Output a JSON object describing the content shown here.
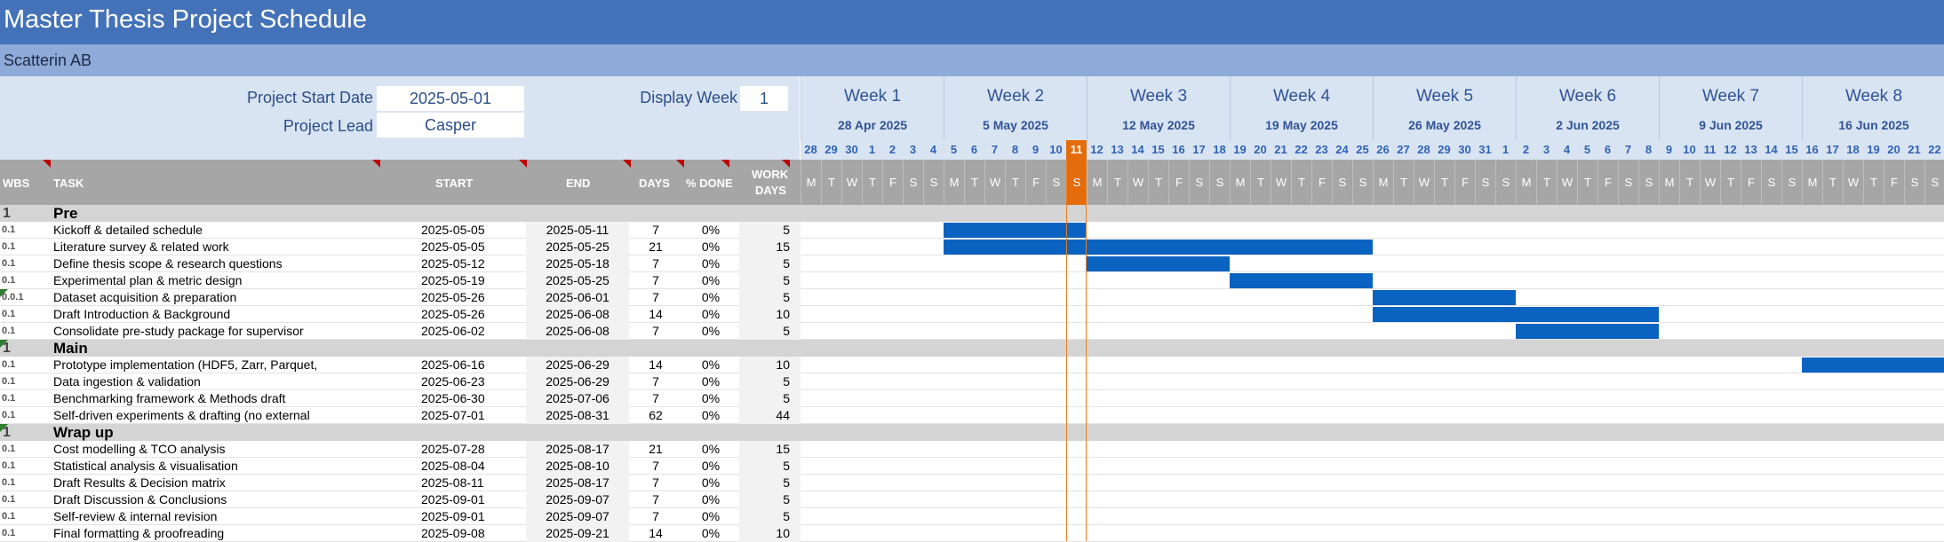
{
  "title": "Master Thesis Project Schedule",
  "company": "Scatterin AB",
  "info": {
    "start_label": "Project Start Date",
    "start_value": "2025-05-01",
    "lead_label": "Project Lead",
    "lead_value": "Casper",
    "display_week_label": "Display Week",
    "display_week_value": "1"
  },
  "weeks": [
    {
      "label": "Week 1",
      "date": "28 Apr 2025",
      "days": [
        "28",
        "29",
        "30",
        "1",
        "2",
        "3",
        "4"
      ]
    },
    {
      "label": "Week 2",
      "date": "5 May 2025",
      "days": [
        "5",
        "6",
        "7",
        "8",
        "9",
        "10",
        "11"
      ]
    },
    {
      "label": "Week 3",
      "date": "12 May 2025",
      "days": [
        "12",
        "13",
        "14",
        "15",
        "16",
        "17",
        "18"
      ]
    },
    {
      "label": "Week 4",
      "date": "19 May 2025",
      "days": [
        "19",
        "20",
        "21",
        "22",
        "23",
        "24",
        "25"
      ]
    },
    {
      "label": "Week 5",
      "date": "26 May 2025",
      "days": [
        "26",
        "27",
        "28",
        "29",
        "30",
        "31",
        "1"
      ]
    },
    {
      "label": "Week 6",
      "date": "2 Jun 2025",
      "days": [
        "2",
        "3",
        "4",
        "5",
        "6",
        "7",
        "8"
      ]
    },
    {
      "label": "Week 7",
      "date": "9 Jun 2025",
      "days": [
        "9",
        "10",
        "11",
        "12",
        "13",
        "14",
        "15"
      ]
    },
    {
      "label": "Week 8",
      "date": "16 Jun 2025",
      "days": [
        "16",
        "17",
        "18",
        "19",
        "20",
        "21",
        "22"
      ]
    }
  ],
  "weekday_letters": [
    "M",
    "T",
    "W",
    "T",
    "F",
    "S",
    "S"
  ],
  "today_index": 13,
  "columns": {
    "wbs": "WBS",
    "task": "TASK",
    "start": "START",
    "end": "END",
    "days": "DAYS",
    "done": "% DONE",
    "work_days_1": "WORK",
    "work_days_2": "DAYS"
  },
  "rows": [
    {
      "type": "phase",
      "wbs": "1",
      "task": "Pre"
    },
    {
      "type": "task",
      "wbs": "0.1",
      "task": "Kickoff & detailed schedule",
      "start": "2025-05-05",
      "end": "2025-05-11",
      "days": "7",
      "done": "0%",
      "work": "5",
      "bar_start": 7,
      "bar_len": 7
    },
    {
      "type": "task",
      "wbs": "0.1",
      "task": "Literature survey & related work",
      "start": "2025-05-05",
      "end": "2025-05-25",
      "days": "21",
      "done": "0%",
      "work": "15",
      "bar_start": 7,
      "bar_len": 21
    },
    {
      "type": "task",
      "wbs": "0.1",
      "task": "Define thesis scope & research questions",
      "start": "2025-05-12",
      "end": "2025-05-18",
      "days": "7",
      "done": "0%",
      "work": "5",
      "bar_start": 14,
      "bar_len": 7
    },
    {
      "type": "task",
      "wbs": "0.1",
      "task": "Experimental plan & metric design",
      "start": "2025-05-19",
      "end": "2025-05-25",
      "days": "7",
      "done": "0%",
      "work": "5",
      "bar_start": 21,
      "bar_len": 7
    },
    {
      "type": "task",
      "wbs": "0.0.1",
      "task": "Dataset acquisition & preparation",
      "start": "2025-05-26",
      "end": "2025-06-01",
      "days": "7",
      "done": "0%",
      "work": "5",
      "bar_start": 28,
      "bar_len": 7,
      "marker": true
    },
    {
      "type": "task",
      "wbs": "0.1",
      "task": "Draft Introduction & Background",
      "start": "2025-05-26",
      "end": "2025-06-08",
      "days": "14",
      "done": "0%",
      "work": "10",
      "bar_start": 28,
      "bar_len": 14
    },
    {
      "type": "task",
      "wbs": "0.1",
      "task": "Consolidate pre-study package for supervisor",
      "start": "2025-06-02",
      "end": "2025-06-08",
      "days": "7",
      "done": "0%",
      "work": "5",
      "bar_start": 35,
      "bar_len": 7
    },
    {
      "type": "phase",
      "wbs": "1",
      "task": "Main",
      "marker": true
    },
    {
      "type": "task",
      "wbs": "0.1",
      "task": "Prototype implementation (HDF5, Zarr, Parquet,",
      "start": "2025-06-16",
      "end": "2025-06-29",
      "days": "14",
      "done": "0%",
      "work": "10",
      "bar_start": 49,
      "bar_len": 14
    },
    {
      "type": "task",
      "wbs": "0.1",
      "task": "Data ingestion & validation",
      "start": "2025-06-23",
      "end": "2025-06-29",
      "days": "7",
      "done": "0%",
      "work": "5",
      "bar_start": 56,
      "bar_len": 7
    },
    {
      "type": "task",
      "wbs": "0.1",
      "task": "Benchmarking framework & Methods draft",
      "start": "2025-06-30",
      "end": "2025-07-06",
      "days": "7",
      "done": "0%",
      "work": "5",
      "bar_start": 63,
      "bar_len": 7
    },
    {
      "type": "task",
      "wbs": "0.1",
      "task": "Self-driven experiments & drafting (no external",
      "start": "2025-07-01",
      "end": "2025-08-31",
      "days": "62",
      "done": "0%",
      "work": "44",
      "bar_start": 64,
      "bar_len": 62
    },
    {
      "type": "phase",
      "wbs": "1",
      "task": "Wrap up",
      "marker": true
    },
    {
      "type": "task",
      "wbs": "0.1",
      "task": "Cost modelling & TCO analysis",
      "start": "2025-07-28",
      "end": "2025-08-17",
      "days": "21",
      "done": "0%",
      "work": "15",
      "bar_start": 91,
      "bar_len": 21
    },
    {
      "type": "task",
      "wbs": "0.1",
      "task": "Statistical analysis & visualisation",
      "start": "2025-08-04",
      "end": "2025-08-10",
      "days": "7",
      "done": "0%",
      "work": "5",
      "bar_start": 98,
      "bar_len": 7
    },
    {
      "type": "task",
      "wbs": "0.1",
      "task": "Draft Results & Decision matrix",
      "start": "2025-08-11",
      "end": "2025-08-17",
      "days": "7",
      "done": "0%",
      "work": "5",
      "bar_start": 105,
      "bar_len": 7
    },
    {
      "type": "task",
      "wbs": "0.1",
      "task": "Draft Discussion & Conclusions",
      "start": "2025-09-01",
      "end": "2025-09-07",
      "days": "7",
      "done": "0%",
      "work": "5",
      "bar_start": 126,
      "bar_len": 7
    },
    {
      "type": "task",
      "wbs": "0.1",
      "task": "Self-review & internal revision",
      "start": "2025-09-01",
      "end": "2025-09-07",
      "days": "7",
      "done": "0%",
      "work": "5",
      "bar_start": 126,
      "bar_len": 7
    },
    {
      "type": "task",
      "wbs": "0.1",
      "task": "Final formatting & proofreading",
      "start": "2025-09-08",
      "end": "2025-09-21",
      "days": "14",
      "done": "0%",
      "work": "10",
      "bar_start": 133,
      "bar_len": 14
    }
  ]
}
